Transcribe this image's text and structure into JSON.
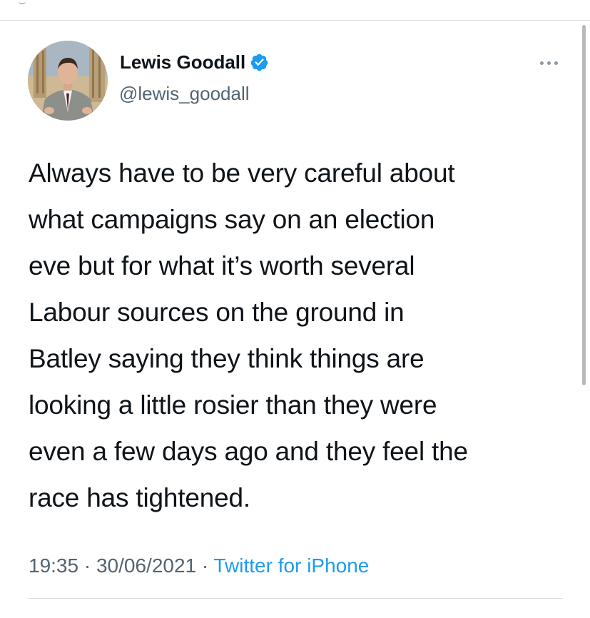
{
  "tweet": {
    "author": {
      "display_name": "Lewis Goodall",
      "handle": "@lewis_goodall",
      "verified": true,
      "avatar_icon": "avatar-photo"
    },
    "text": "Always have to be very careful about\nwhat campaigns say on an election\neve but for what it’s worth several\nLabour sources on the ground in\nBatley saying they think things are\nlooking a little rosier than they were\neven a few days ago and they feel the\nrace has tightened.",
    "time": "19:35",
    "date": "30/06/2021",
    "separator": "·",
    "source": "Twitter for iPhone"
  },
  "colors": {
    "text_primary": "#0f1419",
    "text_secondary": "#536471",
    "accent": "#1d9bf0",
    "divider": "#d9dde1"
  },
  "icons": {
    "verified": "verified-badge-icon",
    "more": "more-options-icon"
  }
}
